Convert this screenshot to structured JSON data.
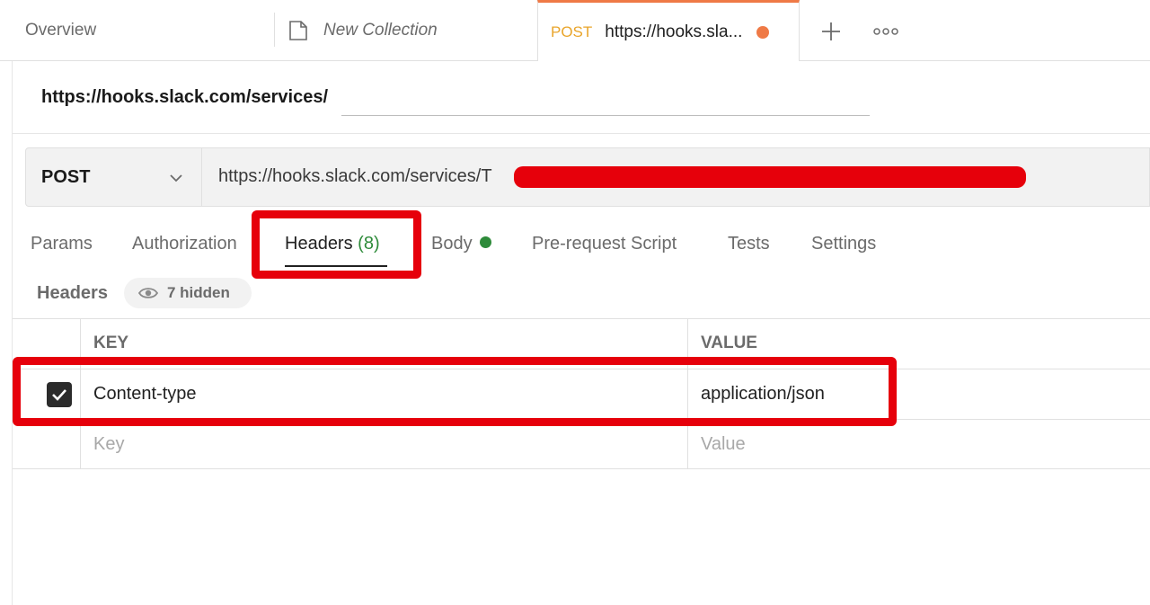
{
  "tabs": {
    "overview": "Overview",
    "collection": "New Collection",
    "request_method": "POST",
    "request_title": "https://hooks.sla..."
  },
  "request": {
    "name": "https://hooks.slack.com/services/",
    "method": "POST",
    "url": "https://hooks.slack.com/services/T"
  },
  "subtabs": {
    "params": "Params",
    "authorization": "Authorization",
    "headers": "Headers",
    "headers_count": "(8)",
    "body": "Body",
    "prerequest": "Pre-request Script",
    "tests": "Tests",
    "settings": "Settings"
  },
  "headers_panel": {
    "label": "Headers",
    "hidden": "7 hidden"
  },
  "table": {
    "key_header": "KEY",
    "value_header": "VALUE",
    "rows": [
      {
        "key": "Content-type",
        "value": "application/json",
        "checked": true
      }
    ],
    "key_placeholder": "Key",
    "value_placeholder": "Value"
  },
  "colors": {
    "accent": "#ef7a46",
    "method_post": "#e9a52b",
    "status_green": "#2e8b3a",
    "highlight": "#e6000b"
  }
}
